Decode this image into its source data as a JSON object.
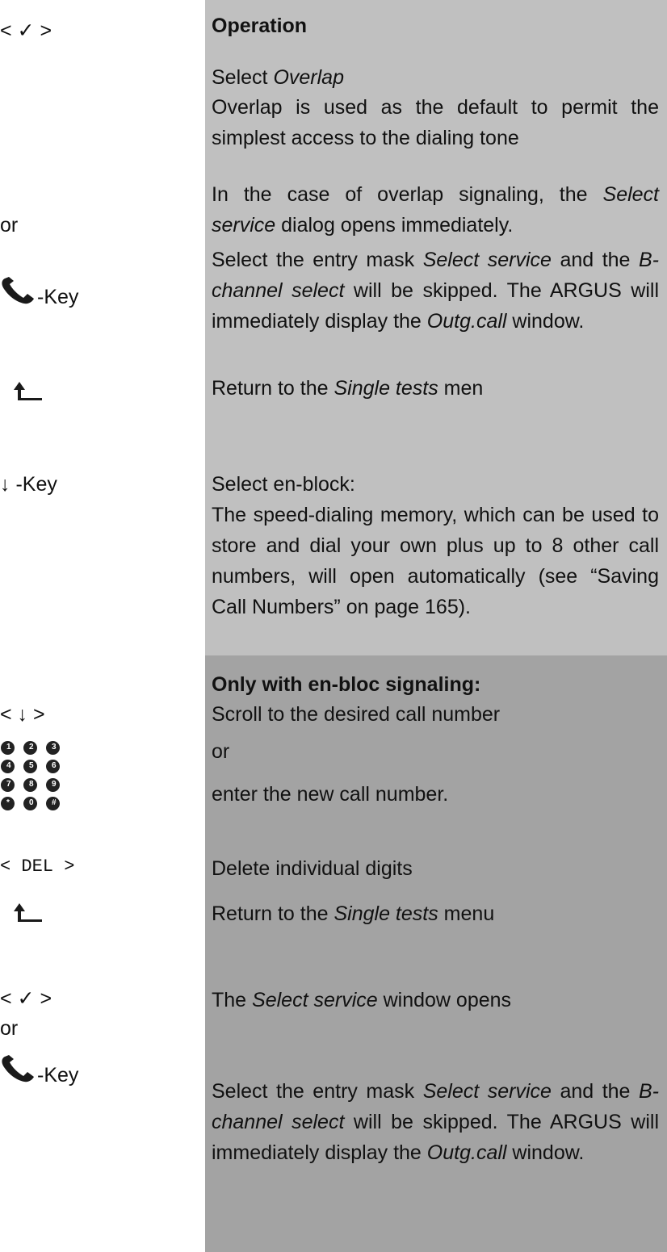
{
  "operation_header": "Operation",
  "keys": {
    "ok_1": "< ✓ >",
    "or_1": "or",
    "key_suffix": "-Key",
    "down_key": "↓ -Key",
    "down_soft": "< ↓ >",
    "del_key": "< DEL >",
    "ok_2": "< ✓ >",
    "or_2": "or"
  },
  "section1": {
    "select_prefix": "Select ",
    "select_em": "Overlap",
    "default_text": "Overlap is used as the default to permit the simplest access to the dialing tone",
    "overlap_p1": "In the case of overlap signaling, the ",
    "overlap_em": "Select service",
    "overlap_p2": " dialog opens immediately.",
    "mask_p1": "Select the entry mask ",
    "mask_em1": "Select service",
    "mask_p2": " and the ",
    "mask_em2": "B-channel select",
    "mask_p3": " will be skipped. The ARGUS will immediately display the ",
    "mask_em3": "Outg.call",
    "mask_p4": " window.",
    "return_p1": "Return to the ",
    "return_em": "Single tests",
    "return_p2": " men",
    "enblock_title": "Select en-block:",
    "enblock_text": "The speed-dialing memory, which can be used to store and dial your own plus up to 8 other call numbers, will open automatically (see “Saving Call Numbers” on page 165)."
  },
  "section2": {
    "header": "Only with en-bloc signaling:",
    "scroll": "Scroll to the desired call number",
    "or": "or",
    "enter": "enter the new call number.",
    "delete": "Delete individual digits",
    "return_p1": "Return to the ",
    "return_em": "Single tests",
    "return_p2": " menu",
    "opens_p1": "The ",
    "opens_em": "Select service",
    "opens_p2": " window opens",
    "mask_p1": "Select the entry mask ",
    "mask_em1": "Select service",
    "mask_p2": " and the ",
    "mask_em2": "B-channel select",
    "mask_p3": " will be skipped. The ARGUS will immediately display the ",
    "mask_em3": "Outg.call",
    "mask_p4": " window."
  },
  "keypad_keys": [
    "1",
    "2",
    "3",
    "4",
    "5",
    "6",
    "7",
    "8",
    "9",
    "*",
    "0",
    "#"
  ],
  "colors": {
    "panel_light": "#c0c0c0",
    "panel_dark": "#a3a3a3"
  }
}
